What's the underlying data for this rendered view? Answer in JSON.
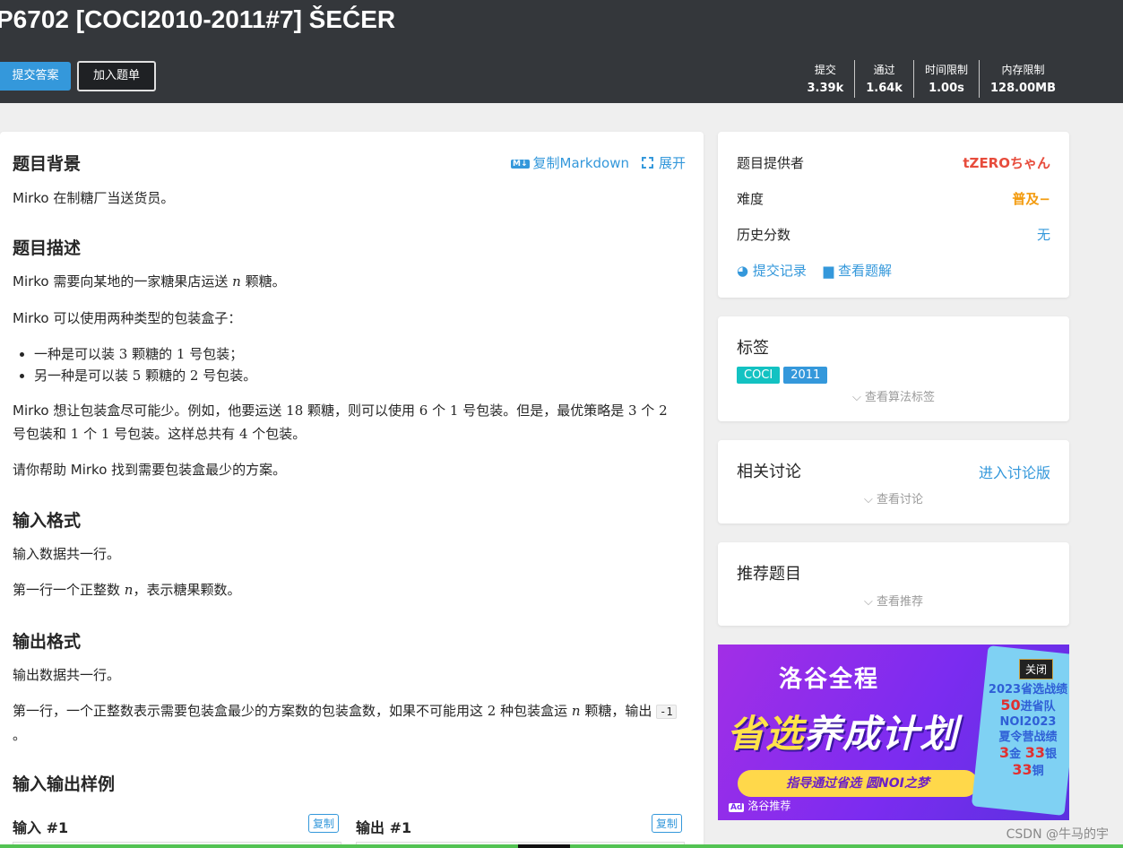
{
  "header": {
    "title": "P6702 [COCI2010-2011#7] ŠEĆER",
    "submit_label": "提交答案",
    "add_label": "加入题单",
    "stats": [
      {
        "label": "提交",
        "value": "3.39k"
      },
      {
        "label": "通过",
        "value": "1.64k"
      },
      {
        "label": "时间限制",
        "value": "1.00s"
      },
      {
        "label": "内存限制",
        "value": "128.00MB"
      }
    ]
  },
  "toolbar": {
    "copy_md_icon": "M↓",
    "copy_markdown": "复制Markdown",
    "expand": "展开"
  },
  "problem": {
    "bg_title": "题目背景",
    "bg_text": "Mirko 在制糖厂当送货员。",
    "desc_title": "题目描述",
    "desc_p1_a": "Mirko 需要向某地的一家糖果店运送 ",
    "desc_p1_var": "n",
    "desc_p1_b": " 颗糖。",
    "desc_p2": "Mirko 可以使用两种类型的包装盒子：",
    "list": [
      {
        "a": "一种是可以装 ",
        "n1": "3",
        "b": " 颗糖的 ",
        "n2": "1",
        "c": " 号包装；"
      },
      {
        "a": "另一种是可以装 ",
        "n1": "5",
        "b": " 颗糖的 ",
        "n2": "2",
        "c": " 号包装。"
      }
    ],
    "desc_p3": {
      "a": "Mirko 想让包装盒尽可能少。例如，他要运送 ",
      "n1": "18",
      "b": " 颗糖，则可以使用 ",
      "n2": "6",
      "c": " 个 ",
      "n3": "1",
      "d": " 号包装。但是，最优策略是 ",
      "n4": "3",
      "e": " 个 ",
      "n5": "2",
      "f": " 号包装和 ",
      "n6": "1",
      "g": " 个 ",
      "n7": "1",
      "h": " 号包装。这样总共有 ",
      "n8": "4",
      "i": " 个包装。"
    },
    "desc_p4": "请你帮助 Mirko 找到需要包装盒最少的方案。",
    "input_title": "输入格式",
    "input_p1": "输入数据共一行。",
    "input_p2_a": "第一行一个正整数 ",
    "input_p2_var": "n",
    "input_p2_b": "，表示糖果颗数。",
    "output_title": "输出格式",
    "output_p1": "输出数据共一行。",
    "output_p2": {
      "a": "第一行，一个正整数表示需要包装盒最少的方案数的包装盒数，如果不可能用这 ",
      "n1": "2",
      "b": " 种包装盒运 ",
      "var": "n",
      "c": " 颗糖，输出 ",
      "code": "-1",
      "d": " 。"
    },
    "sample_title": "输入输出样例",
    "input_sample": "输入 #1",
    "output_sample": "输出 #1",
    "copy": "复制"
  },
  "info": {
    "provider_label": "题目提供者",
    "provider_value": "tZEROちゃん",
    "difficulty_label": "难度",
    "difficulty_value": "普及−",
    "history_label": "历史分数",
    "history_value": "无",
    "submissions_link": "提交记录",
    "solutions_link": "查看题解"
  },
  "tags": {
    "title": "标签",
    "items": [
      {
        "label": "COCI",
        "color": "#13c2c2"
      },
      {
        "label": "2011",
        "color": "#3498db"
      }
    ],
    "more": "查看算法标签"
  },
  "discuss": {
    "title": "相关讨论",
    "link": "进入讨论版",
    "more": "查看讨论"
  },
  "recommend": {
    "title": "推荐题目",
    "more": "查看推荐"
  },
  "ad": {
    "logo": "洛谷全程",
    "headline_a": "省选",
    "headline_b": "养成计划",
    "pill": "指导通过省选 圆NOI之梦",
    "panel_l1": "2023省选战绩",
    "panel_l2_n": "50",
    "panel_l2": "进省队",
    "panel_l3": "NOI2023",
    "panel_l4": "夏令营战绩",
    "panel_l5_n1": "3",
    "panel_l5_a": "金",
    "panel_l5_n2": "33",
    "panel_l5_b": "银",
    "panel_l6_n": "33",
    "panel_l6": "铜",
    "close": "关闭",
    "footer_badge": "Ad",
    "footer": "洛谷推荐"
  },
  "watermark": "CSDN @牛马的宇",
  "colors": {
    "header_bg": "#34373b",
    "accent": "#3498db",
    "provider": "#e74c3c",
    "difficulty": "#f39c11"
  }
}
